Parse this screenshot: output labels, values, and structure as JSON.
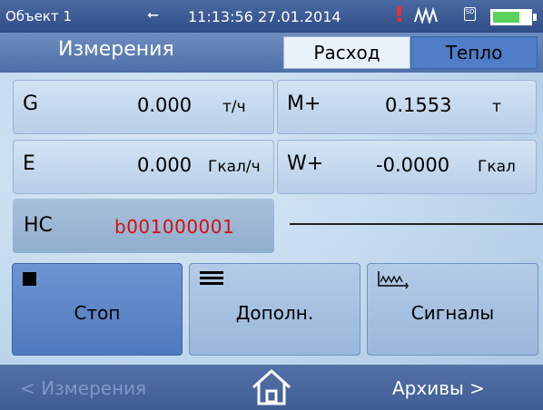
{
  "status_bar": {
    "object": "Объект 1",
    "usb_icon": "usb-icon",
    "time": "11:13:56",
    "date": "27.01.2014",
    "warning": "!",
    "sd_label": "SD",
    "battery_level": 0.7,
    "battery_color": "#5ad25a"
  },
  "header": {
    "title": "Измерения",
    "tabs": [
      {
        "label": "Расход",
        "active": false
      },
      {
        "label": "Тепло",
        "active": true
      }
    ]
  },
  "measurements": {
    "g": {
      "label": "G",
      "value": "0.000",
      "unit": "т/ч"
    },
    "m_plus": {
      "label": "M+",
      "value": "0.1553",
      "unit": "т"
    },
    "e": {
      "label": "E",
      "value": "0.000",
      "unit": "Гкал/ч"
    },
    "w_plus": {
      "label": "W+",
      "value": "-0.0000",
      "unit": "Гкал"
    }
  },
  "hc": {
    "label": "НС",
    "value": "b001000001",
    "value_color": "#d31010"
  },
  "buttons": {
    "stop": {
      "label": "Стоп",
      "icon": "stop-icon"
    },
    "more": {
      "label": "Дополн.",
      "icon": "menu-icon"
    },
    "signals": {
      "label": "Сигналы",
      "icon": "signal-icon"
    }
  },
  "bottom_bar": {
    "back": "< Измерения",
    "home_icon": "home-icon",
    "forward": "Архивы >"
  }
}
